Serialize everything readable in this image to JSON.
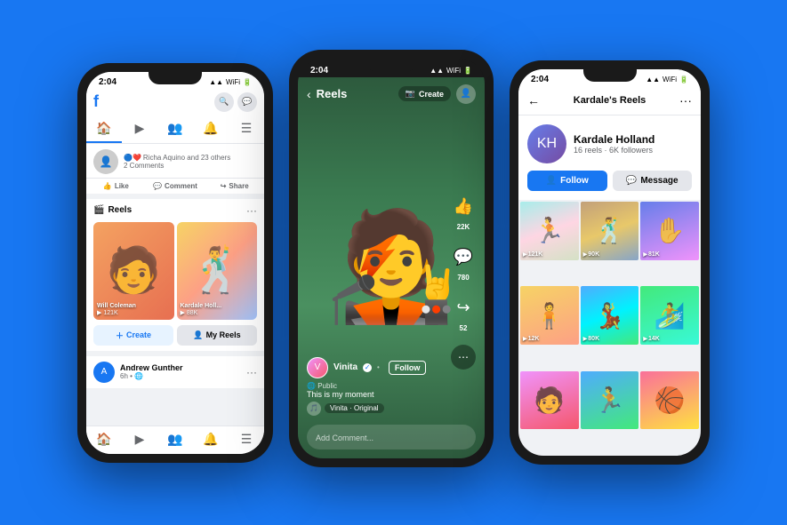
{
  "background_color": "#1877F2",
  "phone1": {
    "status_time": "2:04",
    "status_icons": "▾▾ WiFi 🔋",
    "fb_logo": "f",
    "nav_tabs": [
      "Home",
      "Watch",
      "Groups",
      "Alerts",
      "Menu"
    ],
    "post": {
      "reactions": "🔵❤️",
      "author_line": "Richa Aquino and 23 others",
      "comments": "2 Comments",
      "like": "Like",
      "comment": "Comment",
      "share": "Share"
    },
    "reels_section": {
      "title": "Reels",
      "reels": [
        {
          "name": "Will Coleman",
          "views": "▶ 121K"
        },
        {
          "name": "Kardale Holl...",
          "views": "▶ 88K"
        }
      ],
      "create_btn": "Create",
      "my_reels_btn": "My Reels"
    },
    "post2": {
      "name": "Andrew Gunther",
      "time": "6h • 🌐"
    },
    "bottom_nav": [
      "🏠",
      "▶",
      "👥",
      "🔔",
      "☰"
    ]
  },
  "phone2": {
    "status_time": "2:04",
    "header_title": "Reels",
    "create_label": "Create",
    "user": {
      "name": "Vinita",
      "verified": "✓",
      "follow": "Follow",
      "public": "Public",
      "caption": "This is my moment"
    },
    "music": "Vinita · Original",
    "side_actions": [
      {
        "icon": "👍",
        "count": "22K"
      },
      {
        "icon": "💬",
        "count": "780"
      },
      {
        "icon": "↪",
        "count": "52"
      },
      {
        "icon": "⋯",
        "count": ""
      }
    ],
    "comment_placeholder": "Add Comment..."
  },
  "phone3": {
    "status_time": "2:04",
    "back_label": "←",
    "title": "Kardale's Reels",
    "more_label": "···",
    "profile": {
      "name": "Kardale Holland",
      "stats": "16 reels · 6K followers",
      "follow_btn": "Follow",
      "message_btn": "Message"
    },
    "grid": [
      {
        "views": "121K",
        "gradient": "g1"
      },
      {
        "views": "90K",
        "gradient": "g2"
      },
      {
        "views": "81K",
        "gradient": "g3"
      },
      {
        "views": "12K",
        "gradient": "g4"
      },
      {
        "views": "80K",
        "gradient": "g5"
      },
      {
        "views": "14K",
        "gradient": "g6"
      },
      {
        "views": "",
        "gradient": "g7"
      },
      {
        "views": "",
        "gradient": "g8"
      },
      {
        "views": "",
        "gradient": "g9"
      }
    ]
  }
}
